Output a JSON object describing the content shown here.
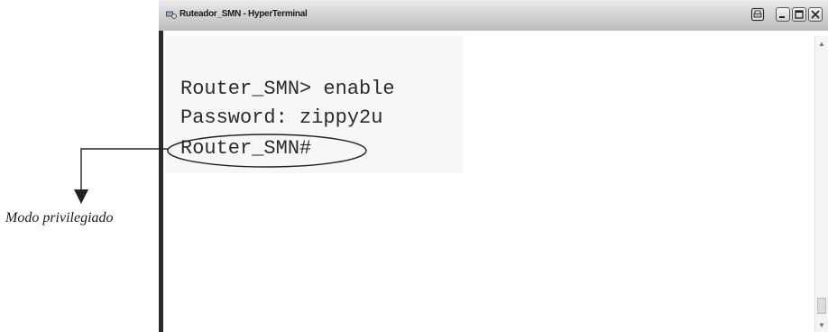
{
  "window": {
    "title": "Ruteador_SMN - HyperTerminal"
  },
  "terminal": {
    "lines": [
      "Router_SMN> enable",
      "Password: zippy2u",
      "Router_SMN#"
    ]
  },
  "annotation": {
    "label": "Modo privilegiado"
  }
}
